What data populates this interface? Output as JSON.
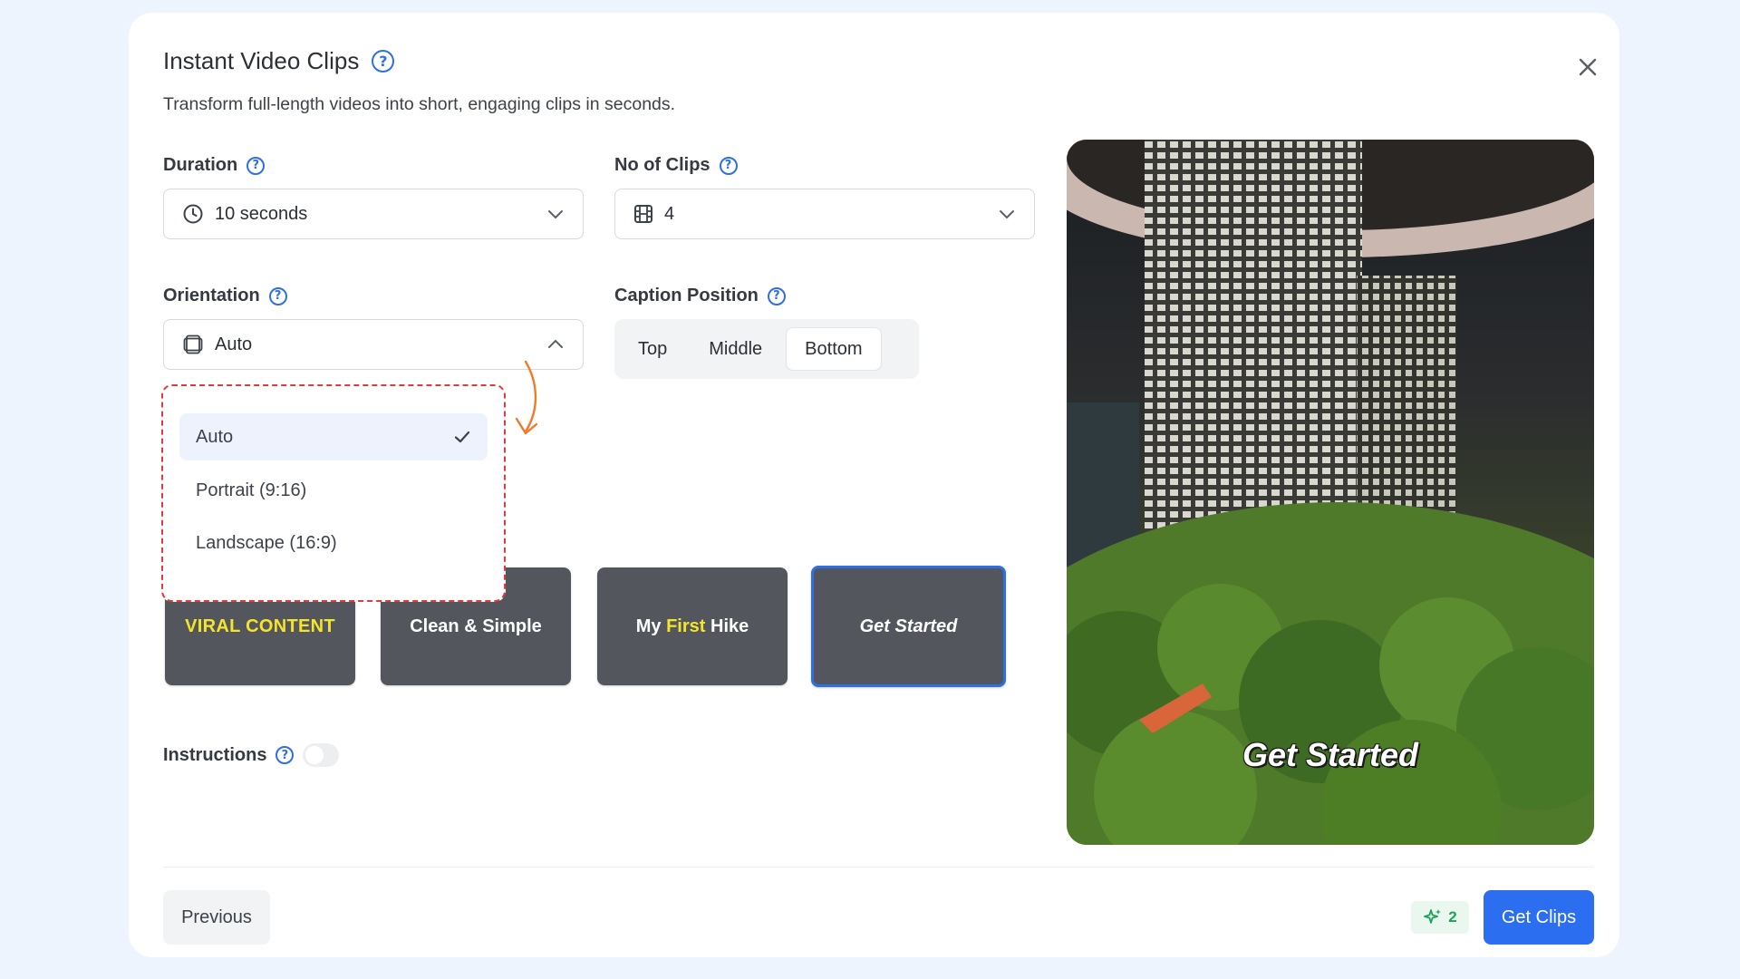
{
  "modal": {
    "title": "Instant Video Clips",
    "subtitle": "Transform full-length videos into short, engaging clips in seconds."
  },
  "duration": {
    "label": "Duration",
    "value": "10 seconds"
  },
  "clips": {
    "label": "No of Clips",
    "value": "4"
  },
  "orientation": {
    "label": "Orientation",
    "value": "Auto",
    "options": [
      "Auto",
      "Portrait (9:16)",
      "Landscape (16:9)"
    ],
    "selected_index": 0
  },
  "caption_position": {
    "label": "Caption Position",
    "options": [
      "Top",
      "Middle",
      "Bottom"
    ],
    "selected": "Bottom"
  },
  "caption_styles": [
    {
      "text": "VIRAL CONTENT"
    },
    {
      "text": "Clean & Simple"
    },
    {
      "parts": [
        "My ",
        "First",
        " Hike"
      ]
    },
    {
      "text": "Get Started",
      "selected": true
    }
  ],
  "instructions": {
    "label": "Instructions",
    "enabled": false
  },
  "preview": {
    "caption": "Get Started"
  },
  "footer": {
    "previous_label": "Previous",
    "credits": "2",
    "get_clips_label": "Get Clips"
  },
  "colors": {
    "accent": "#2b6ef0",
    "highlight": "#f5e52a",
    "dashed_frame": "#e2393b",
    "annotation_arrow": "#f07a2a"
  },
  "icons": {
    "duration": "clock-icon",
    "clips": "film-icon",
    "orientation": "aspect-ratio-icon",
    "close": "close-icon",
    "credits": "sparkles-icon"
  }
}
